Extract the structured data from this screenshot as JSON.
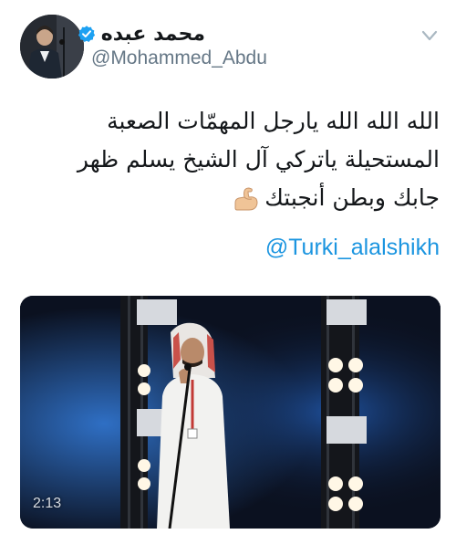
{
  "author": {
    "display_name": "محمد عبده",
    "handle": "@Mohammed_Abdu",
    "verified": true
  },
  "tweet": {
    "lines": [
      "الله الله الله يارجل المهمّات الصعبة",
      "المستحيلة ياتركي آل الشيخ يسلم ظهر",
      "جابك وبطن أنجبتك"
    ],
    "emoji": "flexed-biceps-icon",
    "mention": "@Turki_alalshikh"
  },
  "media": {
    "type": "video",
    "duration": "2:13"
  },
  "colors": {
    "link": "#1b95e0",
    "verified": "#1da1f2",
    "secondary_text": "#657786"
  }
}
